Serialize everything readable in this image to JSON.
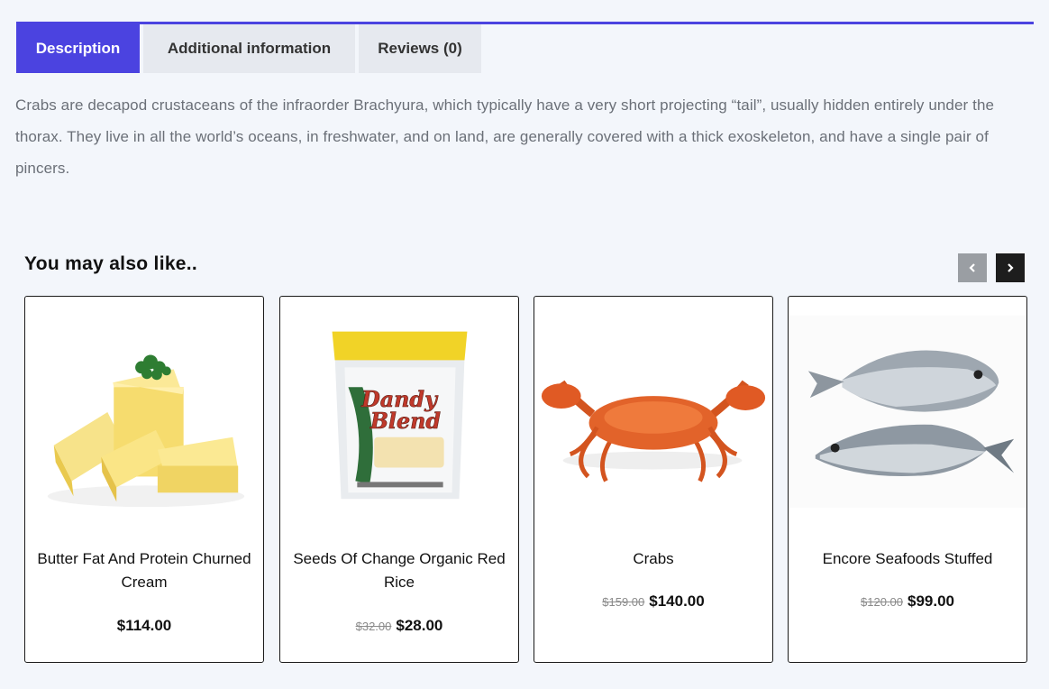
{
  "tabs": {
    "description": "Description",
    "additional": "Additional information",
    "reviews": "Reviews (0)"
  },
  "description_text": "Crabs are decapod crustaceans of the infraorder Brachyura, which typically have a very short projecting “tail”, usually hidden entirely under the thorax. They live in all the world’s oceans, in freshwater, and on land, are generally covered with a thick exoskeleton, and have a single pair of pincers.",
  "related": {
    "title": "You may also like..",
    "prev_icon": "chevron-left-icon",
    "next_icon": "chevron-right-icon",
    "products": [
      {
        "name": "Butter Fat And Protein Churned Cream",
        "old_price": "",
        "price": "$114.00"
      },
      {
        "name": "Seeds Of Change Organic Red Rice",
        "old_price": "$32.00",
        "price": "$28.00"
      },
      {
        "name": "Crabs",
        "old_price": "$159.00",
        "price": "$140.00"
      },
      {
        "name": "Encore Seafoods Stuffed",
        "old_price": "$120.00",
        "price": "$99.00"
      }
    ]
  },
  "colors": {
    "accent": "#4b43e0",
    "tab_inactive": "#e6e9ef",
    "page_bg": "#f3f6fb"
  }
}
